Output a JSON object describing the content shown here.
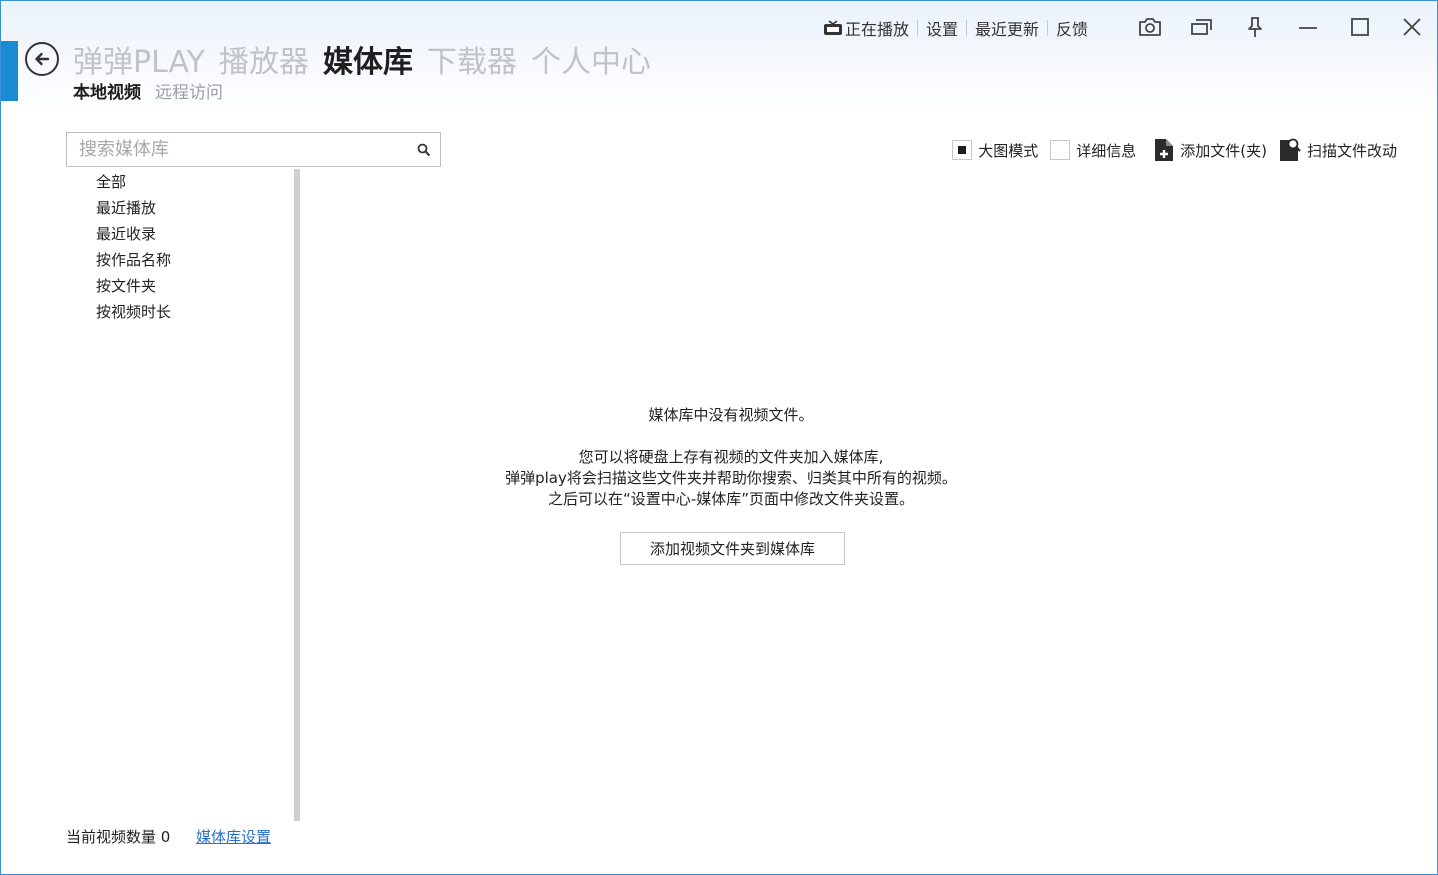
{
  "header": {
    "main_tabs": [
      {
        "label": "弹弹PLAY",
        "active": false
      },
      {
        "label": "播放器",
        "active": false
      },
      {
        "label": "媒体库",
        "active": true
      },
      {
        "label": "下载器",
        "active": false
      },
      {
        "label": "个人中心",
        "active": false
      }
    ],
    "sub_tabs": [
      {
        "label": "本地视频",
        "active": true
      },
      {
        "label": "远程访问",
        "active": false
      }
    ],
    "top_links": {
      "now_playing": "正在播放",
      "settings": "设置",
      "recent_updates": "最近更新",
      "feedback": "反馈"
    },
    "window_controls": [
      "camera-icon",
      "mini-window-icon",
      "pin-icon",
      "minimize-icon",
      "maximize-icon",
      "close-icon"
    ]
  },
  "sidebar": {
    "search_placeholder": "搜索媒体库",
    "items": [
      "全部",
      "最近播放",
      "最近收录",
      "按作品名称",
      "按文件夹",
      "按视频时长"
    ]
  },
  "toolbar": {
    "large_mode_label": "大图模式",
    "large_mode_checked": true,
    "detail_info_label": "详细信息",
    "detail_info_checked": false,
    "add_file_label": "添加文件(夹)",
    "scan_changes_label": "扫描文件改动"
  },
  "empty_state": {
    "title": "媒体库中没有视频文件。",
    "line1": "您可以将硬盘上存有视频的文件夹加入媒体库,",
    "line2": "弹弹play将会扫描这些文件夹并帮助你搜索、归类其中所有的视频。",
    "line3": "之后可以在“设置中心-媒体库”页面中修改文件夹设置。",
    "button_label": "添加视频文件夹到媒体库"
  },
  "footer": {
    "count_label": "当前视频数量 0",
    "settings_link": "媒体库设置"
  },
  "colors": {
    "accent": "#1a8ad4",
    "link": "#2a6fc9",
    "inactive_tab": "#c0c4c8"
  }
}
